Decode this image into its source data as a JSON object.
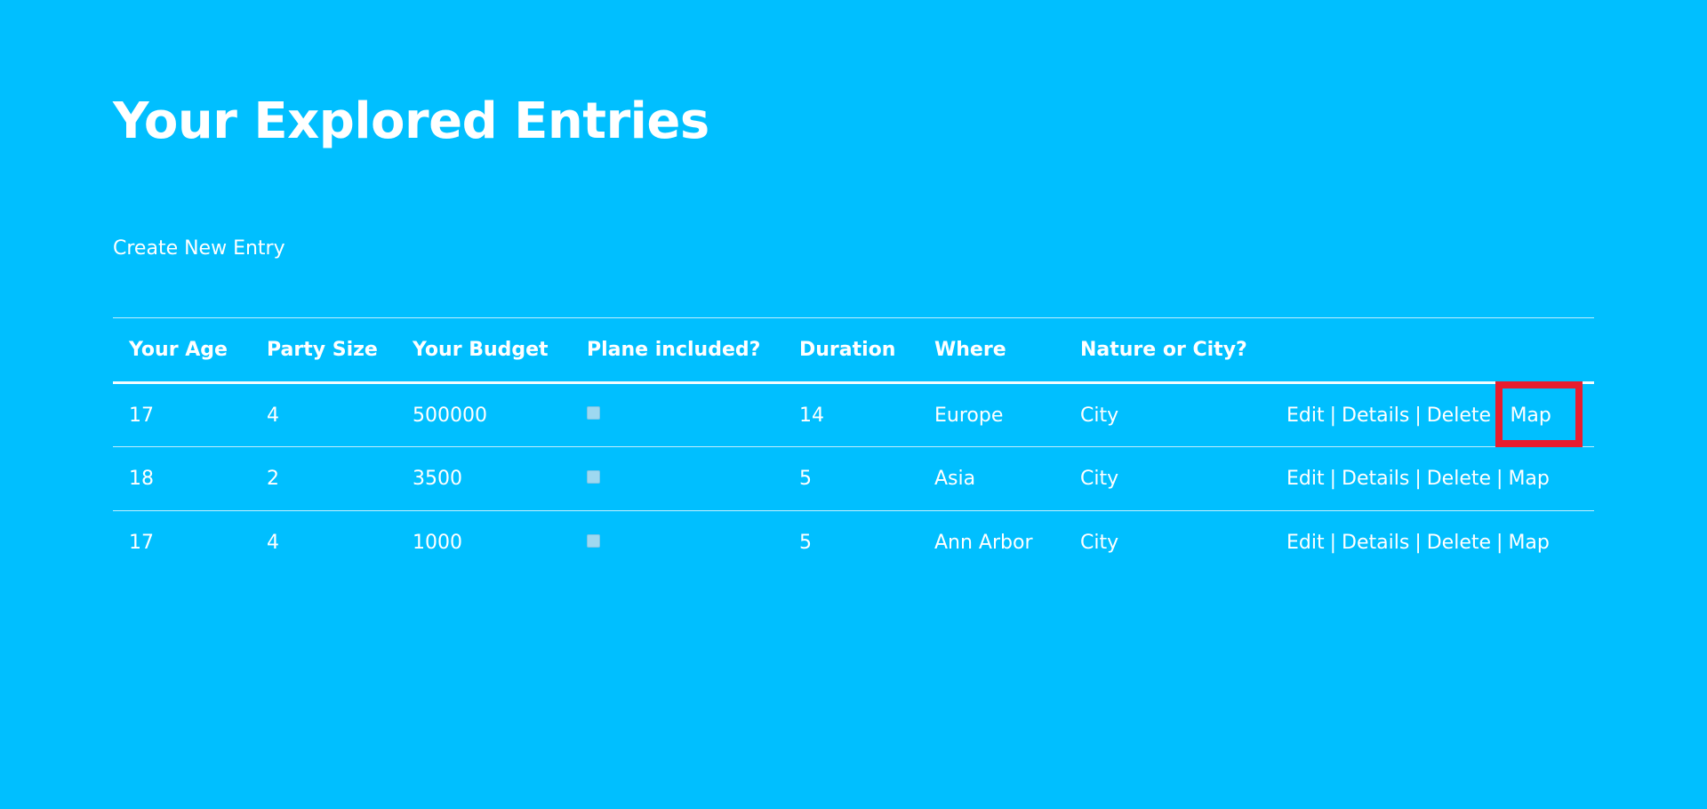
{
  "page": {
    "title": "Your Explored Entries",
    "create_link": "Create New Entry"
  },
  "table": {
    "headers": [
      "Your Age",
      "Party Size",
      "Your Budget",
      "Plane included?",
      "Duration",
      "Where",
      "Nature or City?",
      ""
    ],
    "rows": [
      {
        "age": "17",
        "party_size": "4",
        "budget": "500000",
        "plane_included": false,
        "duration": "14",
        "where": "Europe",
        "nature_or_city": "City"
      },
      {
        "age": "18",
        "party_size": "2",
        "budget": "3500",
        "plane_included": false,
        "duration": "5",
        "where": "Asia",
        "nature_or_city": "City"
      },
      {
        "age": "17",
        "party_size": "4",
        "budget": "1000",
        "plane_included": false,
        "duration": "5",
        "where": "Ann Arbor",
        "nature_or_city": "City"
      }
    ],
    "actions": {
      "edit": "Edit",
      "details": "Details",
      "delete": "Delete",
      "map": "Map",
      "separator": "|"
    }
  },
  "colors": {
    "background": "#00BFFF",
    "text": "#FFFFFF",
    "highlight": "#E81C2E"
  }
}
